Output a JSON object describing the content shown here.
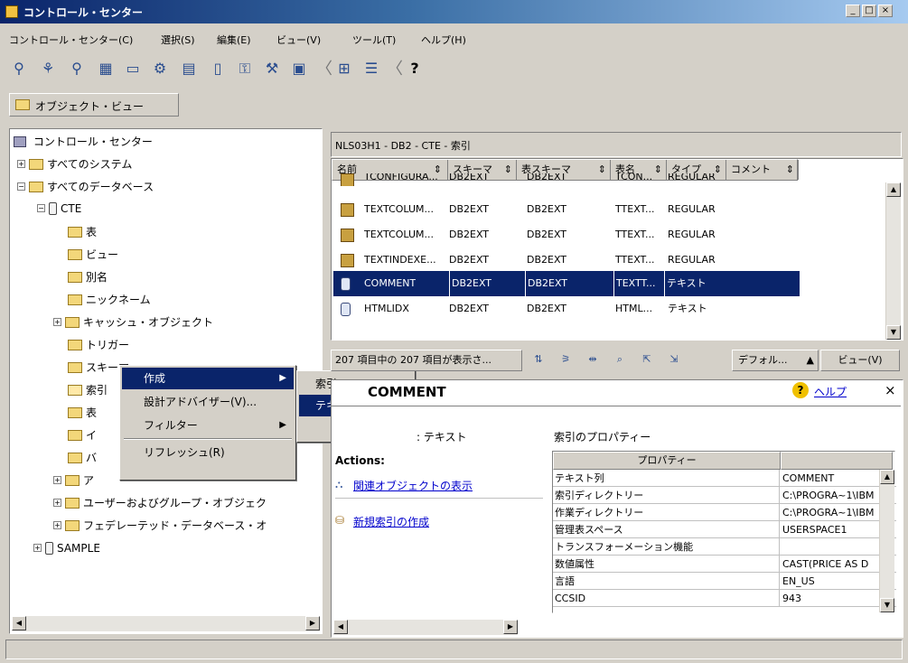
{
  "window": {
    "title": "コントロール・センター",
    "controls": [
      "_",
      "□",
      "×"
    ]
  },
  "menubar": [
    "コントロール・センター(C)",
    "選択(S)",
    "編集(E)",
    "ビュー(V)",
    "ツール(T)",
    "ヘルプ(H)"
  ],
  "toolbar": {
    "help_glyph": "?"
  },
  "object_view_tab": "オブジェクト・ビュー",
  "tree": {
    "root": "コントロール・センター",
    "all_systems": "すべてのシステム",
    "all_databases": "すべてのデータベース",
    "db_cte": "CTE",
    "items": [
      "表",
      "ビュー",
      "別名",
      "ニックネーム",
      "キャッシュ・オブジェクト",
      "トリガー",
      "スキーマ",
      "索引",
      "表",
      "イ",
      "バ",
      "ア",
      "ユーザーおよびグループ・オブジェク",
      "フェデレーテッド・データベース・オ"
    ],
    "db_sample": "SAMPLE"
  },
  "context_menu": {
    "items": [
      "作成",
      "設計アドバイザー(V)...",
      "フィルター",
      "リフレッシュ(R)"
    ],
    "submenu": [
      "索引",
      "テキスト索引"
    ]
  },
  "right": {
    "breadcrumb": "NLS03H1 - DB2 - CTE - 索引",
    "columns": [
      "名前",
      "スキーマ",
      "表スキーマ",
      "表名",
      "タイプ",
      "コメント"
    ],
    "rows": [
      {
        "name": "TCONFIGURA...",
        "schema": "DB2EXT",
        "tabschema": "DB2EXT",
        "tabname": "TCON...",
        "type": "REGULAR",
        "comment": ""
      },
      {
        "name": "TEXTCOLUM...",
        "schema": "DB2EXT",
        "tabschema": "DB2EXT",
        "tabname": "TTEXT...",
        "type": "REGULAR",
        "comment": ""
      },
      {
        "name": "TEXTCOLUM...",
        "schema": "DB2EXT",
        "tabschema": "DB2EXT",
        "tabname": "TTEXT...",
        "type": "REGULAR",
        "comment": ""
      },
      {
        "name": "TEXTINDEXE...",
        "schema": "DB2EXT",
        "tabschema": "DB2EXT",
        "tabname": "TTEXT...",
        "type": "REGULAR",
        "comment": ""
      },
      {
        "name": "COMMENT",
        "schema": "DB2EXT",
        "tabschema": "DB2EXT",
        "tabname": "TEXTT...",
        "type": "テキスト",
        "comment": ""
      },
      {
        "name": "HTMLIDX",
        "schema": "DB2EXT",
        "tabschema": "DB2EXT",
        "tabname": "HTML...",
        "type": "テキスト",
        "comment": ""
      }
    ],
    "status_text": "207 項目中の 207 項目が表示さ...",
    "default_btn": "デフォル...",
    "view_btn": "ビュー(V)"
  },
  "details": {
    "title": "COMMENT",
    "help_link": "ヘルプ",
    "close": "×",
    "subtitle": ": テキスト",
    "prop_header": "索引のプロパティー",
    "actions_label": "Actions:",
    "actions": [
      "関連オブジェクトの表示",
      "新規索引の作成"
    ],
    "prop_col": "プロパティー",
    "props": [
      {
        "k": "テキスト列",
        "v": "COMMENT"
      },
      {
        "k": "索引ディレクトリー",
        "v": "C:\\PROGRA~1\\IBM"
      },
      {
        "k": "作業ディレクトリー",
        "v": "C:\\PROGRA~1\\IBM"
      },
      {
        "k": "管理表スペース",
        "v": "USERSPACE1"
      },
      {
        "k": "トランスフォーメーション機能",
        "v": ""
      },
      {
        "k": "数値属性",
        "v": "CAST(PRICE AS D"
      },
      {
        "k": "言語",
        "v": "EN_US"
      },
      {
        "k": "CCSID",
        "v": "943"
      }
    ]
  }
}
